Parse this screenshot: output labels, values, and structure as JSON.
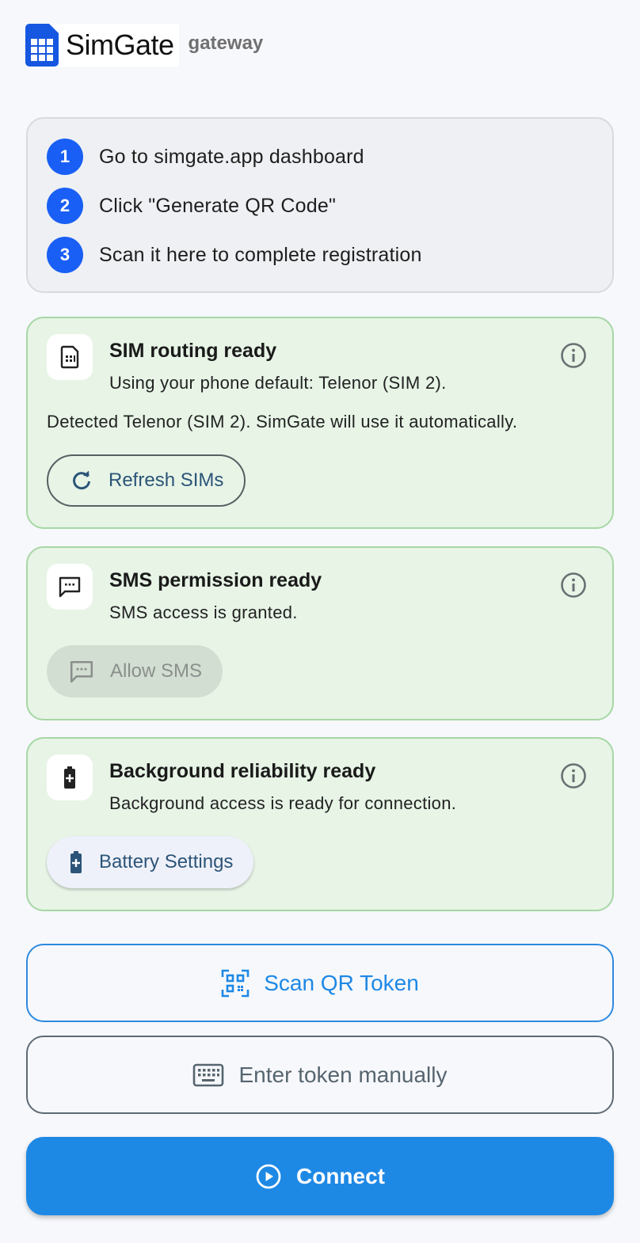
{
  "brand": {
    "name": "SimGate",
    "subtitle": "gateway"
  },
  "steps": [
    {
      "number": "1",
      "text": "Go to simgate.app dashboard"
    },
    {
      "number": "2",
      "text": "Click \"Generate QR Code\""
    },
    {
      "number": "3",
      "text": "Scan it here to complete registration"
    }
  ],
  "sim_card": {
    "title": "SIM routing ready",
    "subtitle": "Using your phone default: Telenor (SIM 2).",
    "detail": "Detected Telenor (SIM 2). SimGate will use it automatically.",
    "button_label": "Refresh SIMs",
    "icon": "sim-card-icon"
  },
  "sms_card": {
    "title": "SMS permission ready",
    "subtitle": "SMS access is granted.",
    "button_label": "Allow SMS",
    "icon": "message-icon"
  },
  "battery_card": {
    "title": "Background reliability ready",
    "subtitle": "Background access is ready for connection.",
    "button_label": "Battery Settings",
    "icon": "battery-icon"
  },
  "actions": {
    "scan_label": "Scan QR Token",
    "manual_label": "Enter token manually",
    "connect_label": "Connect"
  },
  "colors": {
    "accent": "#1e88e5",
    "step_badge": "#1a5ff5",
    "ready_card_bg": "#e7f4e6",
    "ready_card_border": "#a6d7a5"
  }
}
